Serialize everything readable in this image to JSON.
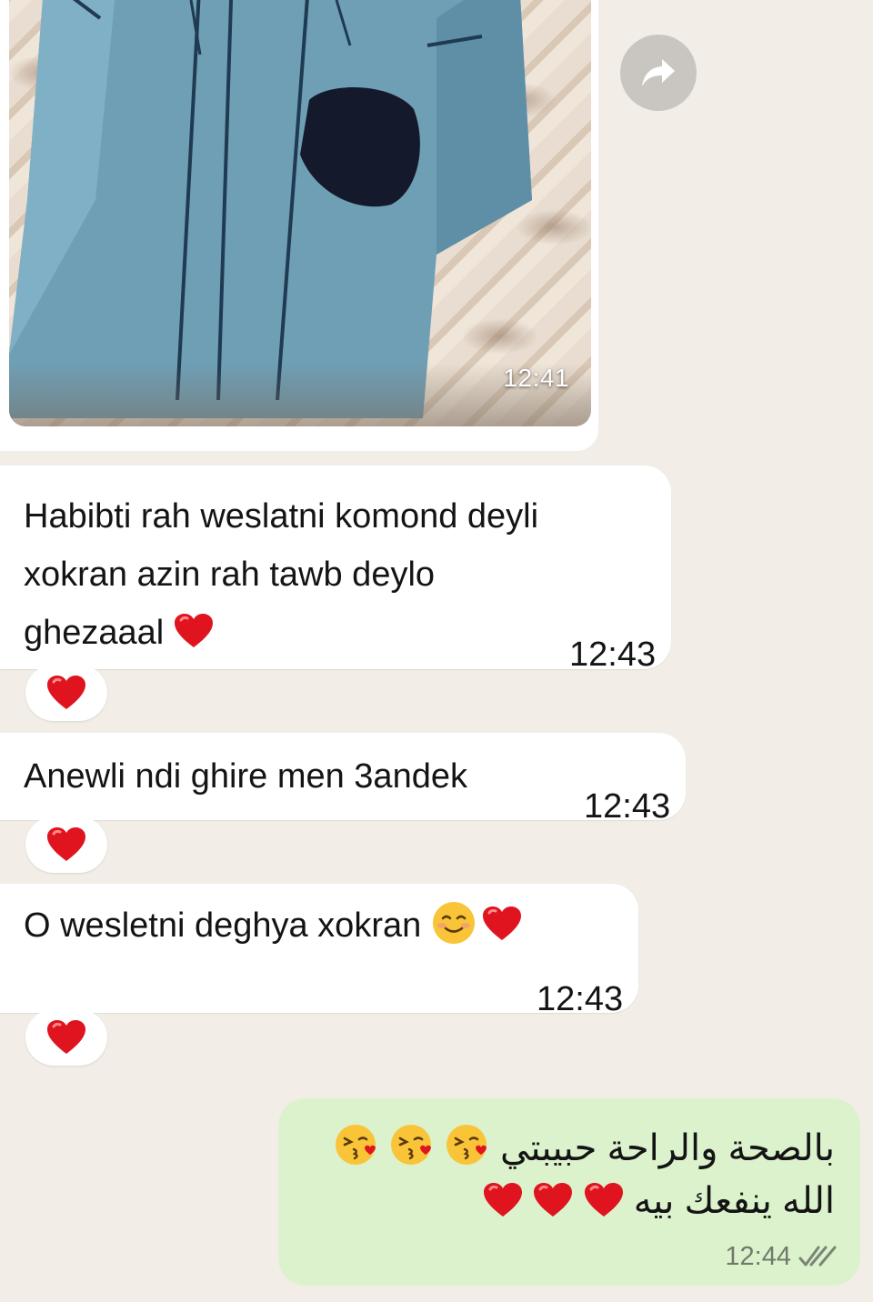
{
  "image_message": {
    "time": "12:41",
    "forward_icon": "forward-icon"
  },
  "messages": [
    {
      "text_lines": [
        "Habibti rah weslatni komond deyli",
        "xokran azin rah tawb deylo",
        "ghezaaal"
      ],
      "emoji": [
        "red-heart"
      ],
      "time": "12:43",
      "reaction": "red-heart"
    },
    {
      "text_lines": [
        "Anewli ndi ghire men 3andek"
      ],
      "emoji": [],
      "time": "12:43",
      "reaction": "red-heart"
    },
    {
      "text_lines": [
        "O wesletni deghya xokran"
      ],
      "emoji": [
        "smiling-face",
        "red-heart"
      ],
      "time": "12:43",
      "reaction": "red-heart"
    }
  ],
  "sent_message": {
    "line1": "بالصحة والراحة حبيبتي",
    "line2": "الله ينفعك بيه",
    "line1_emoji": [
      "face-blowing-kiss",
      "face-blowing-kiss",
      "face-blowing-kiss"
    ],
    "line2_emoji": [
      "red-heart",
      "red-heart",
      "red-heart"
    ],
    "time": "12:44",
    "status_icon": "double-check-icon"
  },
  "colors": {
    "background": "#f2eee7",
    "incoming_bubble": "#ffffff",
    "outgoing_bubble": "#dcf2cd",
    "heart": "#e0141e"
  }
}
